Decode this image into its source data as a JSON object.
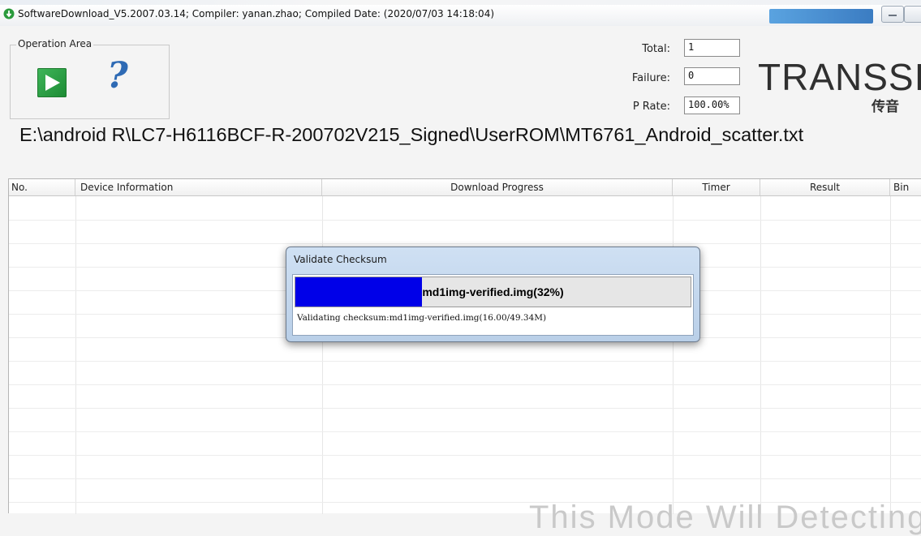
{
  "window": {
    "title": "SoftwareDownload_V5.2007.03.14; Compiler: yanan.zhao; Compiled Date: (2020/07/03 14:18:04)"
  },
  "operation_area": {
    "legend": "Operation Area",
    "start_icon": "play-icon",
    "help_icon": "help-icon"
  },
  "stats": {
    "total_label": "Total:",
    "total_value": "1",
    "failure_label": "Failure:",
    "failure_value": "0",
    "prate_label": "P Rate:",
    "prate_value": "100.00%"
  },
  "brand": {
    "logo": "TRANSSIC",
    "logo_sub": "传音"
  },
  "scatter_path": "E:\\android R\\LC7-H6116BCF-R-200702V215_Signed\\UserROM\\MT6761_Android_scatter.txt",
  "table": {
    "columns": [
      "No.",
      "Device Information",
      "Download Progress",
      "Timer",
      "Result",
      "Bin"
    ]
  },
  "dialog": {
    "title": "Validate Checksum",
    "progress_label": "md1img-verified.img(32%)",
    "progress_fraction": 0.32,
    "status": "Validating checksum:md1img-verified.img(16.00/49.34M)"
  },
  "watermark": "This Mode Will Detecting D",
  "colors": {
    "progress_fill": "#0000e8",
    "play_green": "#2aa548",
    "help_blue": "#2e6ab4"
  }
}
